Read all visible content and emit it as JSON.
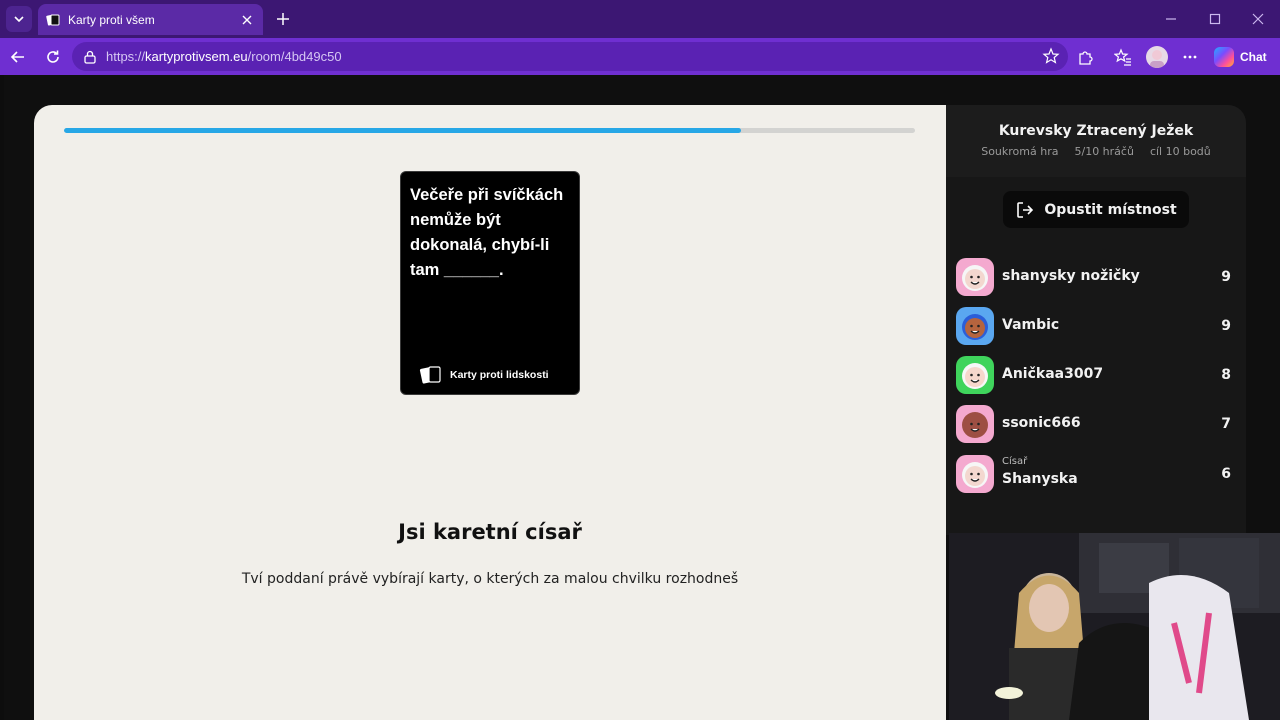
{
  "browser": {
    "tab_title": "Karty proti všem",
    "url_scheme": "https://",
    "url_host": "kartyprotivsem.eu",
    "url_path": "/room/4bd49c50",
    "chat_label": "Chat"
  },
  "game": {
    "progress_fraction": 0.795,
    "black_card": {
      "text": "Večeře při svíčkách nemůže být dokonalá, chybí-li tam ______.",
      "brand": "Karty proti lidskosti"
    },
    "czar_title": "Jsi karetní císař",
    "czar_subtitle": "Tví poddaní právě vybírají karty, o kterých za malou chvilku rozhodneš"
  },
  "sidebar": {
    "room_name": "Kurevsky Ztracený Ježek",
    "room_type": "Soukromá hra",
    "players_count": "5/10 hráčů",
    "goal": "cíl 10 bodů",
    "leave_label": "Opustit místnost",
    "players": [
      {
        "name": "shanysky nožičky",
        "score": "9",
        "role": "",
        "avatar_color": "#f4a9cf",
        "skin": "#f3d7cf",
        "hair": "#f6f6f6"
      },
      {
        "name": "Vambic",
        "score": "9",
        "role": "",
        "avatar_color": "#5aa7f0",
        "skin": "#b5643e",
        "hair": "#2b5ed8"
      },
      {
        "name": "Aničkaa3007",
        "score": "8",
        "role": "",
        "avatar_color": "#3fd45c",
        "skin": "#f6d7cc",
        "hair": "#f7f7f7"
      },
      {
        "name": "ssonic666",
        "score": "7",
        "role": "",
        "avatar_color": "#f4a9cf",
        "skin": "#9d4f43",
        "hair": "#9d4f43"
      },
      {
        "name": "Shanyska",
        "score": "6",
        "role": "Císař",
        "avatar_color": "#f4a9cf",
        "skin": "#f3d7cf",
        "hair": "#f6f6f6"
      }
    ]
  },
  "colors": {
    "tabbar": "#3c1773",
    "toolbar": "#6f2fd1",
    "progress": "#27a7e6",
    "game_bg": "#f1efea",
    "sidebar_bg": "#171717"
  }
}
